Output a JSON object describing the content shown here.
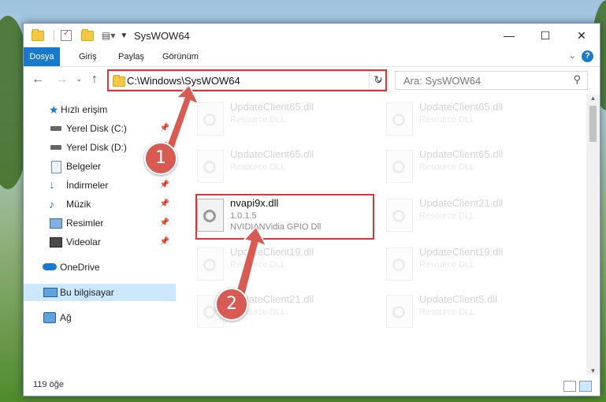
{
  "window": {
    "title": "SysWOW64",
    "controls": {
      "minimize": "—",
      "maximize": "☐",
      "close": "✕"
    }
  },
  "ribbon": {
    "tabs": [
      "Dosya",
      "Giriş",
      "Paylaş",
      "Görünüm"
    ],
    "help": "?"
  },
  "address": {
    "path": "C:\\Windows\\SysWOW64",
    "search_placeholder": "Ara: SysWOW64"
  },
  "sidebar": {
    "items": [
      {
        "label": "Hızlı erişim",
        "icon": "star-icon",
        "pinned": false
      },
      {
        "label": "Yerel Disk (C:)",
        "icon": "drive-icon",
        "pinned": true
      },
      {
        "label": "Yerel Disk (D:)",
        "icon": "drive-icon",
        "pinned": true
      },
      {
        "label": "Belgeler",
        "icon": "document-icon",
        "pinned": true
      },
      {
        "label": "İndirmeler",
        "icon": "download-icon",
        "pinned": true
      },
      {
        "label": "Müzik",
        "icon": "music-icon",
        "pinned": true
      },
      {
        "label": "Resimler",
        "icon": "pictures-icon",
        "pinned": true
      },
      {
        "label": "Videolar",
        "icon": "video-icon",
        "pinned": true
      },
      {
        "label": "OneDrive",
        "icon": "cloud-icon",
        "pinned": false
      },
      {
        "label": "Bu bilgisayar",
        "icon": "computer-icon",
        "pinned": false,
        "selected": true
      },
      {
        "label": "Ağ",
        "icon": "network-icon",
        "pinned": false
      }
    ]
  },
  "files": [
    {
      "name": "UpdateClient65.dll",
      "line2": "Resource DLL",
      "line3": ""
    },
    {
      "name": "UpdateClient65.dll",
      "line2": "Resource DLL",
      "line3": ""
    },
    {
      "name": "UpdateClient65.dll",
      "line2": "Resource DLL",
      "line3": ""
    },
    {
      "name": "UpdateClient65.dll",
      "line2": "Resource DLL",
      "line3": ""
    },
    {
      "name": "nvapi9x.dll",
      "line2": "1.0.1.5",
      "line3": "NVIDIANVidia GPIO Dll",
      "active": true
    },
    {
      "name": "UpdateClient21.dll",
      "line2": "Resource DLL",
      "line3": ""
    },
    {
      "name": "UpdateClient19.dll",
      "line2": "Resource DLL",
      "line3": ""
    },
    {
      "name": "UpdateClient19.dll",
      "line2": "Resource DLL",
      "line3": ""
    },
    {
      "name": "UpdateClient21.dll",
      "line2": "Resource DLL",
      "line3": ""
    },
    {
      "name": "UpdateClient5.dll",
      "line2": "Resource DLL",
      "line3": ""
    }
  ],
  "status": {
    "count": "119 öğe"
  },
  "annotations": {
    "step1": "1",
    "step2": "2"
  },
  "colors": {
    "accent": "#1979ca",
    "highlight": "#d23a3a",
    "badge": "#d95a52"
  }
}
